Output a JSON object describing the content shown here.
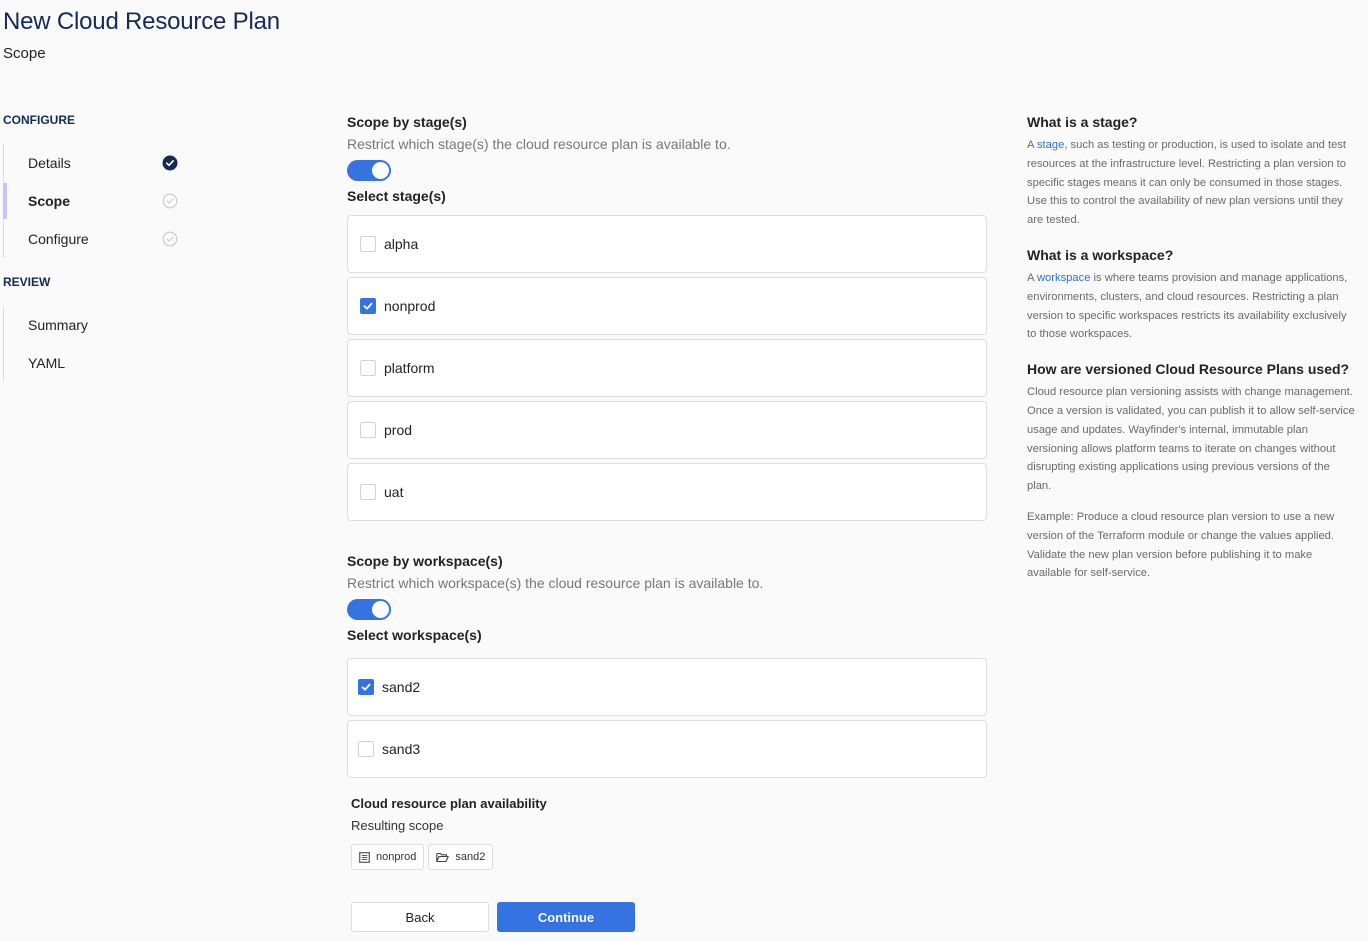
{
  "header": {
    "title": "New Cloud Resource Plan",
    "subtitle": "Scope"
  },
  "sidebar": {
    "sections": [
      {
        "label": "CONFIGURE",
        "items": [
          {
            "label": "Details",
            "status": "complete"
          },
          {
            "label": "Scope",
            "status": "pending",
            "active": true
          },
          {
            "label": "Configure",
            "status": "pending"
          }
        ]
      },
      {
        "label": "REVIEW",
        "items": [
          {
            "label": "Summary"
          },
          {
            "label": "YAML"
          }
        ]
      }
    ]
  },
  "stages": {
    "title": "Scope by stage(s)",
    "description": "Restrict which stage(s) the cloud resource plan is available to.",
    "toggle_on": true,
    "select_label": "Select stage(s)",
    "options": [
      {
        "label": "alpha",
        "checked": false
      },
      {
        "label": "nonprod",
        "checked": true
      },
      {
        "label": "platform",
        "checked": false
      },
      {
        "label": "prod",
        "checked": false
      },
      {
        "label": "uat",
        "checked": false
      }
    ]
  },
  "workspaces": {
    "title": "Scope by workspace(s)",
    "description": "Restrict which workspace(s) the cloud resource plan is available to.",
    "toggle_on": true,
    "select_label": "Select workspace(s)",
    "options": [
      {
        "label": "sand2",
        "checked": true
      },
      {
        "label": "sand3",
        "checked": false
      }
    ]
  },
  "availability": {
    "title": "Cloud resource plan availability",
    "subtitle": "Resulting scope",
    "chips": [
      {
        "label": "nonprod",
        "icon": "stage-icon"
      },
      {
        "label": "sand2",
        "icon": "folder-icon"
      }
    ]
  },
  "actions": {
    "back_label": "Back",
    "continue_label": "Continue"
  },
  "help": {
    "stage": {
      "title": "What is a stage?",
      "prefix": "A ",
      "link": "stage",
      "text": ", such as testing or production, is used to isolate and test resources at the infrastructure level. Restricting a plan version to specific stages means it can only be consumed in those stages. Use this to control the availability of new plan versions until they are tested."
    },
    "workspace": {
      "title": "What is a workspace?",
      "prefix": "A ",
      "link": "workspace",
      "text": " is where teams provision and manage applications, environments, clusters, and cloud resources. Restricting a plan version to specific workspaces restricts its availability exclusively to those workspaces."
    },
    "versioning": {
      "title": "How are versioned Cloud Resource Plans used?",
      "text": "Cloud resource plan versioning assists with change management. Once a version is validated, you can publish it to allow self-service usage and updates. Wayfinder's internal, immutable plan versioning allows platform teams to iterate on changes without disrupting existing applications using previous versions of the plan.",
      "example": "Example: Produce a cloud resource plan version to use a new version of the Terraform module or change the values applied. Validate the new plan version before publishing it to make available for self-service."
    }
  },
  "colors": {
    "accent": "#3574e0",
    "title": "#142a57",
    "active_indicator": "#c7c3f5"
  }
}
